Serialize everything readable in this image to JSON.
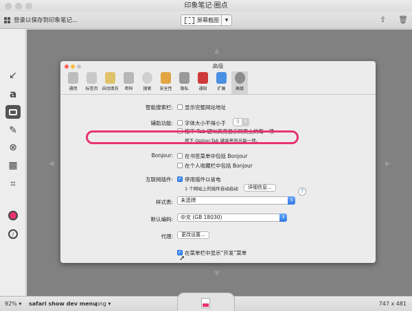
{
  "window": {
    "title": "印象笔记·圈点"
  },
  "toolbar": {
    "save_label": "登录以保存到印象笔记...",
    "capture_label": "屏幕截图"
  },
  "tools": [
    "arrow-tool",
    "text-tool",
    "shape-tool",
    "pen-tool",
    "stamp-tool",
    "pixelate-tool",
    "crop-tool",
    "color-picker",
    "marker-tool"
  ],
  "prefs": {
    "title": "高级",
    "tabs": [
      {
        "label": "通用",
        "color": "#bdbdbd"
      },
      {
        "label": "标签页",
        "color": "#c9c9c9"
      },
      {
        "label": "自动填充",
        "color": "#e0c26a"
      },
      {
        "label": "密码",
        "color": "#b7b7b7"
      },
      {
        "label": "搜索",
        "color": "#cfcfcf"
      },
      {
        "label": "安全性",
        "color": "#e1a543"
      },
      {
        "label": "隐私",
        "color": "#9a9a9a"
      },
      {
        "label": "通知",
        "color": "#cf3a3a"
      },
      {
        "label": "扩展",
        "color": "#4b8fe3"
      },
      {
        "label": "高级",
        "color": "#8c8c8c"
      }
    ],
    "smart_search_label": "智能搜索栏:",
    "smart_search_opt": "显示完整网站地址",
    "access_label": "辅助功能:",
    "access_opt1": "字体大小不得小于",
    "access_font_value": "9",
    "access_opt2": "按下 Tab 键以高亮显示网页上的每一项",
    "access_note": "按下 Option-Tab 键高亮显示每一项。",
    "bonjour_label": "Bonjour:",
    "bonjour_opt1": "在书签菜单中包括 Bonjour",
    "bonjour_opt2": "在个人收藏栏中包括 Bonjour",
    "plugins_label": "互联网插件:",
    "plugins_opt": "停用插件以省电",
    "plugins_note": "1 个网站上的插件自动启动",
    "plugins_btn": "详细信息...",
    "stylesheet_label": "样式表:",
    "stylesheet_value": "未选择",
    "encoding_label": "默认编码:",
    "encoding_value": "中文 (GB 18030)",
    "proxy_label": "代理:",
    "proxy_btn": "更改设置...",
    "devmenu_opt": "在菜单栏中显示“开发”菜单",
    "help": "?"
  },
  "bottom": {
    "zoom": "92%",
    "filename": "safari show dev menu",
    "ext": ".png",
    "dims": "747 x 481"
  },
  "colors": {
    "highlight": "#e7336f",
    "accent": "#3b8ef3"
  }
}
